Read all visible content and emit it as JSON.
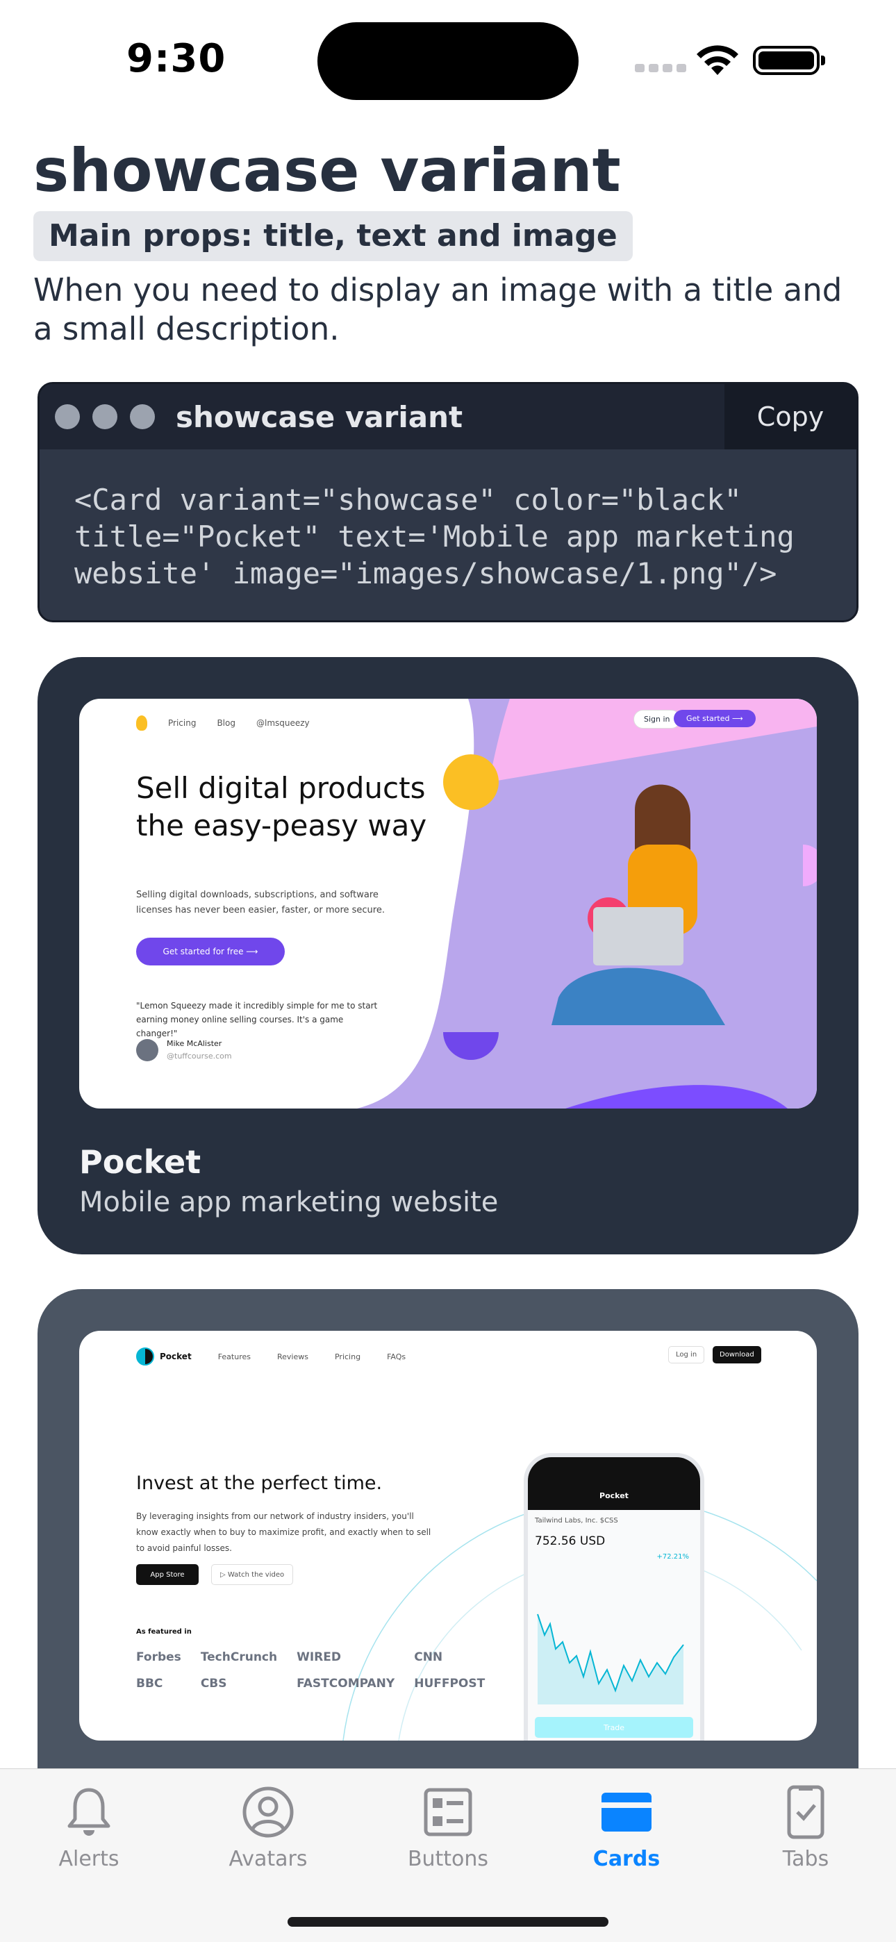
{
  "status": {
    "time": "9:30"
  },
  "header": {
    "title": "showcase variant",
    "props": "Main props: title, text and image",
    "description": "When you need to display an image with a title and a small description."
  },
  "code": {
    "title": "showcase variant",
    "copy_label": "Copy",
    "snippet": "<Card variant=\"showcase\" color=\"black\"\ntitle=\"Pocket\" text='Mobile app marketing\nwebsite' image=\"images/showcase/1.png\"/>"
  },
  "cards": [
    {
      "title": "Pocket",
      "text": "Mobile app marketing website",
      "shot": {
        "nav": [
          "Pricing",
          "Blog",
          "@lmsqueezy"
        ],
        "sign_in": "Sign in",
        "get_started": "Get started ⟶",
        "headline": "Sell digital products the easy-peasy way",
        "body": "Selling digital downloads, subscriptions, and software licenses has never been easier, faster, or more secure.",
        "cta": "Get started for free ⟶",
        "quote": "\"Lemon Squeezy made it incredibly simple for me to start earning money online selling courses. It's a game changer!\"",
        "author_name": "Mike McAlister",
        "author_site": "@tuffcourse.com"
      }
    },
    {
      "shot": {
        "brand": "Pocket",
        "nav": [
          "Features",
          "Reviews",
          "Pricing",
          "FAQs"
        ],
        "login": "Log in",
        "download": "Download",
        "headline": "Invest at the perfect time.",
        "body": "By leveraging insights from our network of industry insiders, you'll know exactly when to buy to maximize profit, and exactly when to sell to avoid painful losses.",
        "app_store": "App Store",
        "watch": "▷ Watch the video",
        "featured": "As featured in",
        "logos": [
          "Forbes",
          "TechCrunch",
          "WIRED",
          "CNN",
          "BBC",
          "CBS",
          "FASTCOMPANY",
          "HUFFPOST"
        ],
        "phone_brand": "Pocket",
        "ticker": "Tailwind Labs, Inc.  $CSS",
        "price": "752.56 USD",
        "change": "+72.21%",
        "trade": "Trade"
      }
    }
  ],
  "tabs": [
    {
      "label": "Alerts",
      "icon": "bell-icon",
      "active": false
    },
    {
      "label": "Avatars",
      "icon": "user-circle-icon",
      "active": false
    },
    {
      "label": "Buttons",
      "icon": "buttons-icon",
      "active": false
    },
    {
      "label": "Cards",
      "icon": "card-icon",
      "active": true
    },
    {
      "label": "Tabs",
      "icon": "phone-check-icon",
      "active": false
    }
  ],
  "colors": {
    "accent": "#0a84ff",
    "card_black": "#27303f",
    "card_gray": "#4b5563",
    "lemon_purple": "#7047eb"
  }
}
